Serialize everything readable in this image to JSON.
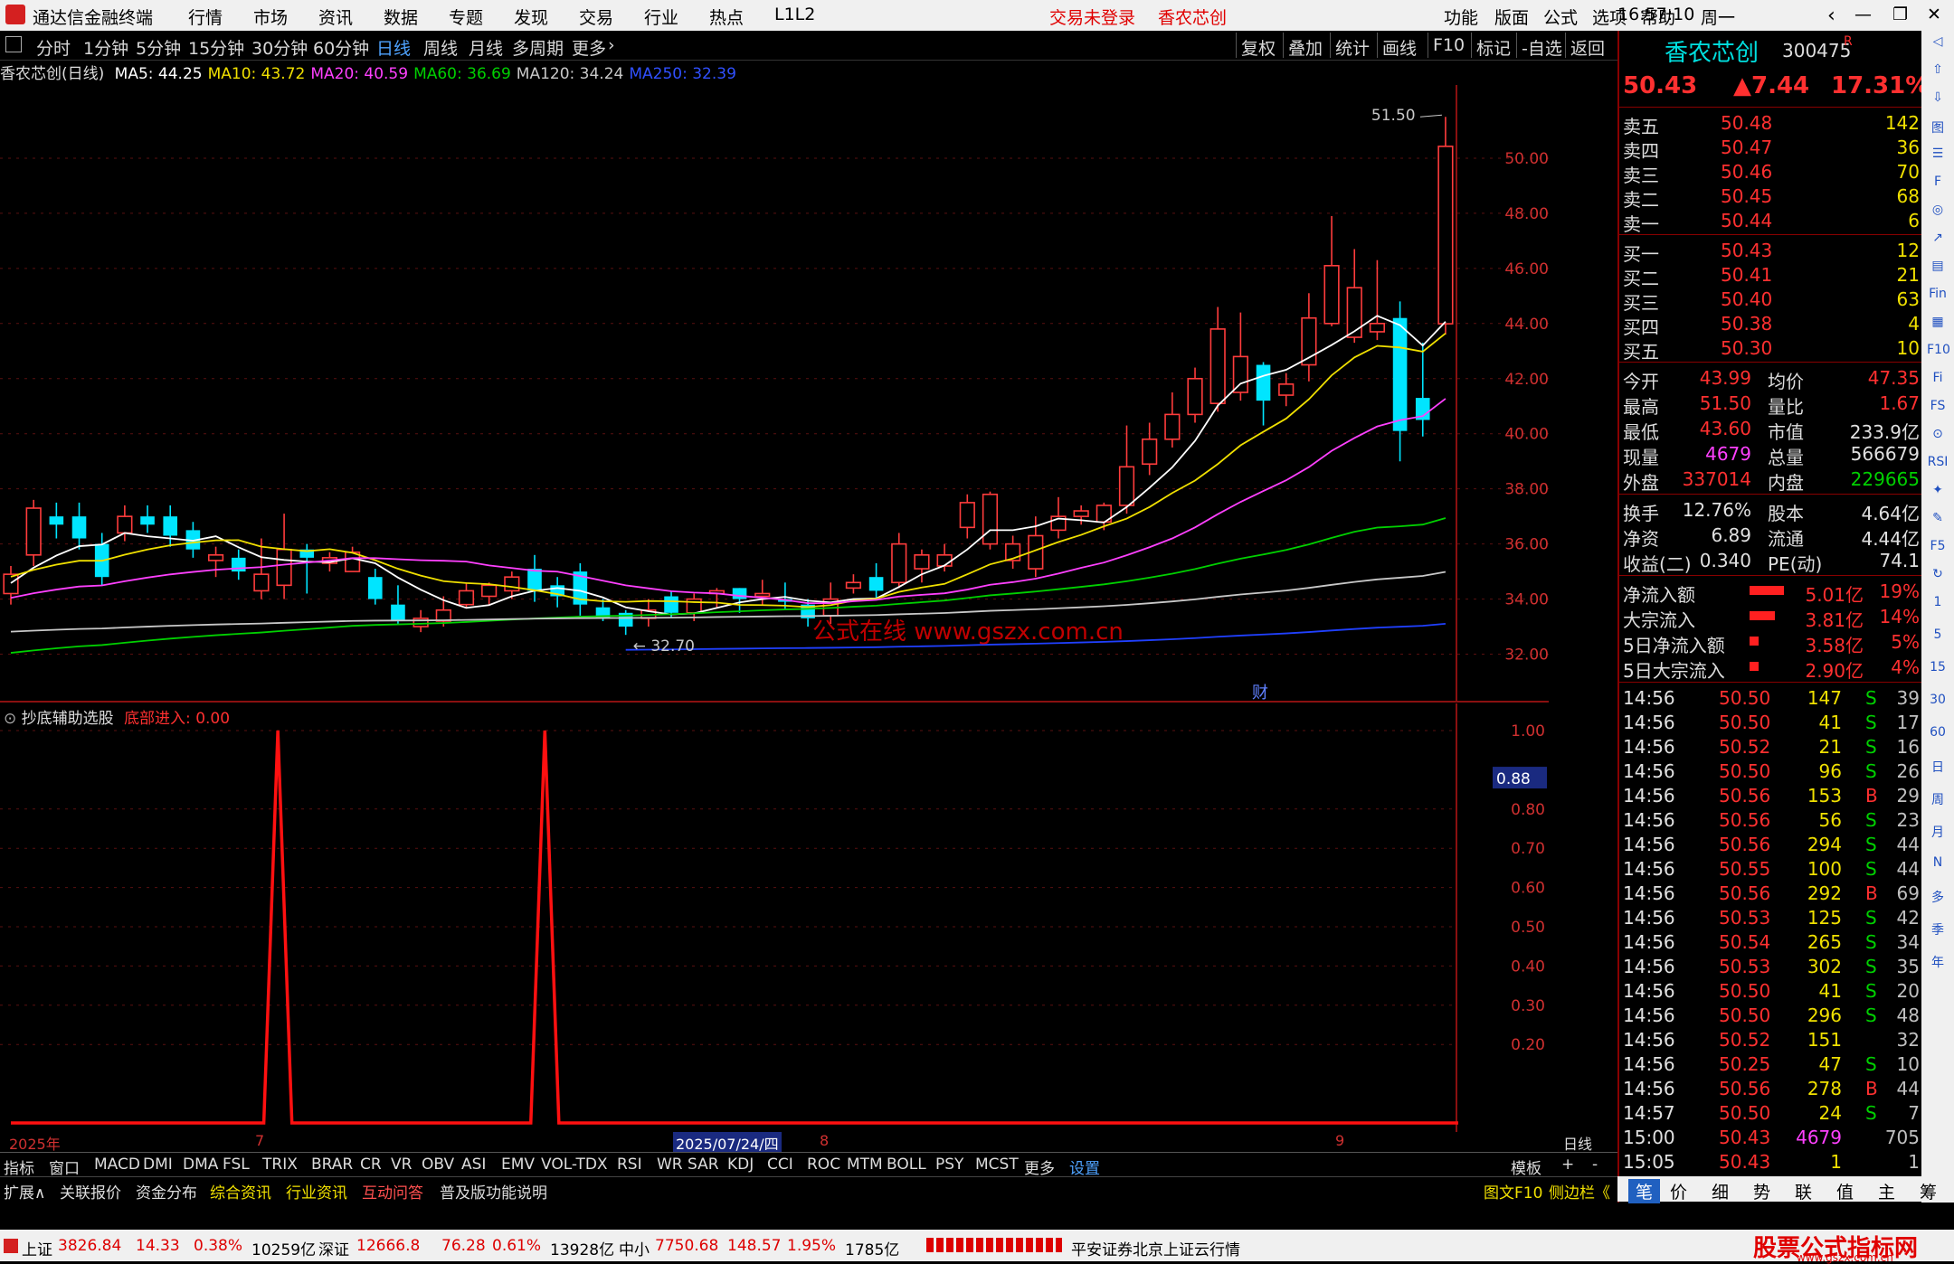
{
  "titlebar": {
    "app_name": "通达信金融终端",
    "menus": [
      "行情",
      "市场",
      "资讯",
      "数据",
      "专题",
      "发现",
      "交易",
      "行业",
      "热点",
      "L1L2"
    ],
    "trade_status": "交易未登录",
    "stock_name_title": "香农芯创",
    "right_menus": [
      "功能",
      "版面",
      "公式",
      "选项",
      "帮助"
    ],
    "clock": "16:57:10",
    "weekday": "周一"
  },
  "periodbar": {
    "periods": [
      "分时",
      "1分钟",
      "5分钟",
      "15分钟",
      "30分钟",
      "60分钟",
      "日线",
      "周线",
      "月线",
      "多周期",
      "更多"
    ],
    "active_period": "日线",
    "right_tools": [
      "复权",
      "叠加",
      "统计",
      "画线",
      "F10",
      "标记",
      "-自选",
      "返回"
    ]
  },
  "infoline": {
    "stock_label": "香农芯创(日线)",
    "ma": [
      {
        "label": "MA5: 44.25",
        "color": "#ffffff"
      },
      {
        "label": "MA10: 43.72",
        "color": "#f0e000"
      },
      {
        "label": "MA20: 40.59",
        "color": "#ff40ff"
      },
      {
        "label": "MA60: 36.69",
        "color": "#00d000"
      },
      {
        "label": "MA120: 34.24",
        "color": "#c8c8c8"
      },
      {
        "label": "MA250: 32.39",
        "color": "#3050ff"
      }
    ]
  },
  "mainchart": {
    "price_ticks": [
      "50.00",
      "48.00",
      "46.00",
      "44.00",
      "42.00",
      "40.00",
      "38.00",
      "36.00",
      "34.00",
      "32.00"
    ],
    "high_marker": "51.50",
    "low_marker": "32.70",
    "watermark": "公式在线 www.gszx.com.cn",
    "fin_label": "财"
  },
  "subchart": {
    "title": "抄底辅助选股",
    "indicator_label": "底部进入: 0.00",
    "ticks": [
      "1.00",
      "0.80",
      "0.70",
      "0.60",
      "0.50",
      "0.40",
      "0.30",
      "0.20"
    ],
    "cursor_value": "0.88",
    "signal_values": [
      0,
      0,
      0,
      0,
      0,
      0,
      0,
      0,
      0,
      0,
      0,
      0,
      0,
      0,
      0,
      0,
      0,
      0,
      0,
      1,
      0,
      0,
      0,
      0,
      0,
      0,
      0,
      0,
      0,
      0,
      0,
      0,
      0,
      0,
      0,
      0,
      0,
      0,
      1,
      0,
      0,
      0,
      0,
      0,
      0,
      0,
      0,
      0,
      0,
      0,
      0,
      0,
      0,
      0,
      0,
      0,
      0,
      0,
      0,
      0,
      0,
      0,
      0,
      0,
      0,
      0,
      0,
      0,
      0,
      0,
      0,
      0,
      0,
      0,
      0,
      0,
      0,
      0,
      0,
      0,
      0,
      0,
      0,
      0,
      0,
      0,
      0,
      0,
      0,
      0,
      0,
      0,
      0,
      0,
      0,
      0,
      0,
      0,
      0,
      0,
      0,
      0,
      0,
      0
    ]
  },
  "axisrow": {
    "labels": [
      "2025年",
      "7",
      "2025/07/24/四",
      "8",
      "9"
    ],
    "period_label": "日线"
  },
  "indbar": {
    "items": [
      "指标",
      "窗口",
      "MACD",
      "DMI",
      "DMA",
      "FSL",
      "TRIX",
      "BRAR",
      "CR",
      "VR",
      "OBV",
      "ASI",
      "EMV",
      "VOL-TDX",
      "RSI",
      "WR",
      "SAR",
      "KDJ",
      "CCI",
      "ROC",
      "MTM",
      "BOLL",
      "PSY",
      "MCST",
      "更多",
      "设置"
    ],
    "right": [
      "模板",
      "+",
      "-"
    ]
  },
  "extbar": {
    "items": [
      "扩展∧",
      "关联报价",
      "资金分布",
      "综合资讯",
      "行业资讯",
      "互动问答",
      "普及版功能说明"
    ],
    "right": [
      "图文F10",
      "侧边栏《"
    ]
  },
  "quote": {
    "name": "香农芯创",
    "code": "300475",
    "flag": "R",
    "price": "50.43",
    "change": "▲7.44",
    "pct": "17.31%",
    "asks": [
      {
        "label": "卖五",
        "price": "50.48",
        "vol": "142"
      },
      {
        "label": "卖四",
        "price": "50.47",
        "vol": "36"
      },
      {
        "label": "卖三",
        "price": "50.46",
        "vol": "70"
      },
      {
        "label": "卖二",
        "price": "50.45",
        "vol": "68"
      },
      {
        "label": "卖一",
        "price": "50.44",
        "vol": "6"
      }
    ],
    "bids": [
      {
        "label": "买一",
        "price": "50.43",
        "vol": "12"
      },
      {
        "label": "买二",
        "price": "50.41",
        "vol": "21"
      },
      {
        "label": "买三",
        "price": "50.40",
        "vol": "63"
      },
      {
        "label": "买四",
        "price": "50.38",
        "vol": "4"
      },
      {
        "label": "买五",
        "price": "50.30",
        "vol": "10"
      }
    ],
    "stats": [
      {
        "l1": "今开",
        "v1": "43.99",
        "l2": "均价",
        "v2": "47.35",
        "c1": "red",
        "c2": "red"
      },
      {
        "l1": "最高",
        "v1": "51.50",
        "l2": "量比",
        "v2": "1.67",
        "c1": "red",
        "c2": "red"
      },
      {
        "l1": "最低",
        "v1": "43.60",
        "l2": "市值",
        "v2": "233.9亿",
        "c1": "red",
        "c2": "white"
      },
      {
        "l1": "现量",
        "v1": "4679",
        "l2": "总量",
        "v2": "566679",
        "c1": "magenta",
        "c2": "white"
      },
      {
        "l1": "外盘",
        "v1": "337014",
        "l2": "内盘",
        "v2": "229665",
        "c1": "red",
        "c2": "green"
      }
    ],
    "stats2": [
      {
        "l1": "换手",
        "v1": "12.76%",
        "l2": "股本",
        "v2": "4.64亿"
      },
      {
        "l1": "净资",
        "v1": "6.89",
        "l2": "流通",
        "v2": "4.44亿"
      },
      {
        "l1": "收益(二)",
        "v1": "0.340",
        "l2": "PE(动)",
        "v2": "74.1"
      }
    ],
    "flows": [
      {
        "label": "净流入额",
        "value": "5.01亿",
        "pct": "19%",
        "bar": 0.19
      },
      {
        "label": "大宗流入",
        "value": "3.81亿",
        "pct": "14%",
        "bar": 0.14
      },
      {
        "label": "5日净流入额",
        "value": "3.58亿",
        "pct": "5%",
        "bar": 0.05
      },
      {
        "label": "5日大宗流入",
        "value": "2.90亿",
        "pct": "4%",
        "bar": 0.04
      }
    ],
    "ticks": [
      {
        "t": "14:56",
        "p": "50.50",
        "v": "147",
        "s": "S",
        "n": "39"
      },
      {
        "t": "14:56",
        "p": "50.50",
        "v": "41",
        "s": "S",
        "n": "17"
      },
      {
        "t": "14:56",
        "p": "50.52",
        "v": "21",
        "s": "S",
        "n": "16"
      },
      {
        "t": "14:56",
        "p": "50.50",
        "v": "96",
        "s": "S",
        "n": "26"
      },
      {
        "t": "14:56",
        "p": "50.56",
        "v": "153",
        "s": "B",
        "n": "29"
      },
      {
        "t": "14:56",
        "p": "50.56",
        "v": "56",
        "s": "S",
        "n": "23"
      },
      {
        "t": "14:56",
        "p": "50.56",
        "v": "294",
        "s": "S",
        "n": "44"
      },
      {
        "t": "14:56",
        "p": "50.55",
        "v": "100",
        "s": "S",
        "n": "44"
      },
      {
        "t": "14:56",
        "p": "50.56",
        "v": "292",
        "s": "B",
        "n": "69"
      },
      {
        "t": "14:56",
        "p": "50.53",
        "v": "125",
        "s": "S",
        "n": "42"
      },
      {
        "t": "14:56",
        "p": "50.54",
        "v": "265",
        "s": "S",
        "n": "34"
      },
      {
        "t": "14:56",
        "p": "50.53",
        "v": "302",
        "s": "S",
        "n": "35"
      },
      {
        "t": "14:56",
        "p": "50.50",
        "v": "41",
        "s": "S",
        "n": "20"
      },
      {
        "t": "14:56",
        "p": "50.50",
        "v": "296",
        "s": "S",
        "n": "48"
      },
      {
        "t": "14:56",
        "p": "50.52",
        "v": "151",
        "s": "",
        "n": "32"
      },
      {
        "t": "14:56",
        "p": "50.25",
        "v": "47",
        "s": "S",
        "n": "10"
      },
      {
        "t": "14:56",
        "p": "50.56",
        "v": "278",
        "s": "B",
        "n": "44"
      },
      {
        "t": "14:57",
        "p": "50.50",
        "v": "24",
        "s": "S",
        "n": "7"
      },
      {
        "t": "15:00",
        "p": "50.43",
        "v": "4679",
        "s": "",
        "n": "705"
      },
      {
        "t": "15:05",
        "p": "50.43",
        "v": "1",
        "s": "",
        "n": "1"
      }
    ]
  },
  "bottomtabs": [
    "笔",
    "价",
    "细",
    "势",
    "联",
    "值",
    "主",
    "筹"
  ],
  "sidetools": [
    "◁",
    "⇧",
    "⇩",
    "图",
    "☰",
    "F",
    "◎",
    "↗",
    "▤",
    "Fin",
    "▦",
    "F10",
    "Fi",
    "FS",
    "⊙",
    "RSI",
    "✦",
    "✎",
    "F5",
    "↻",
    "1",
    "5",
    "15",
    "30",
    "60",
    "日",
    "周",
    "月",
    "N",
    "多",
    "季",
    "年"
  ],
  "statusbar": {
    "sh_label": "上证",
    "sh_value": "3826.84",
    "sh_chg": "14.33",
    "sh_pct": "0.38%",
    "sh_amt": "10259亿",
    "sz_label": "深证",
    "sz_value": "12666.8",
    "sz_chg": "76.28",
    "sz_pct": "0.61%",
    "sz_amt": "13928亿",
    "zx_label": "中小",
    "zx_value": "7750.68",
    "zx_chg": "148.57",
    "zx_pct": "1.95%",
    "zx_amt": "1785亿",
    "broker": "平安证券北京上证云行情",
    "brand_title": "股票公式指标网",
    "brand_url": "www.gszx.com.cn"
  },
  "chart_data": {
    "type": "candlestick",
    "title": "香农芯创(日线)",
    "ylim": [
      31,
      52
    ],
    "candles": [
      [
        34.2,
        34.9,
        33.8,
        35.2
      ],
      [
        35.6,
        37.3,
        35.2,
        37.6
      ],
      [
        37.0,
        36.7,
        36.2,
        37.5
      ],
      [
        37.0,
        36.2,
        35.8,
        37.5
      ],
      [
        36.0,
        34.8,
        34.5,
        36.4
      ],
      [
        36.4,
        37.0,
        36.1,
        37.4
      ],
      [
        37.0,
        36.7,
        36.4,
        37.4
      ],
      [
        37.0,
        36.3,
        35.9,
        37.4
      ],
      [
        36.5,
        35.8,
        35.5,
        36.8
      ],
      [
        35.4,
        35.6,
        34.8,
        35.9
      ],
      [
        35.5,
        35.0,
        34.7,
        35.8
      ],
      [
        34.3,
        34.9,
        34.0,
        36.2
      ],
      [
        34.5,
        35.8,
        34.0,
        37.1
      ],
      [
        35.8,
        35.5,
        34.2,
        36.0
      ],
      [
        35.3,
        35.5,
        35.0,
        35.7
      ],
      [
        35.0,
        35.7,
        35.0,
        35.9
      ],
      [
        34.8,
        34.0,
        33.8,
        35.1
      ],
      [
        33.8,
        33.2,
        33.1,
        34.5
      ],
      [
        33.0,
        33.3,
        32.8,
        33.6
      ],
      [
        33.2,
        33.6,
        33.0,
        34.1
      ],
      [
        33.8,
        34.3,
        33.7,
        34.6
      ],
      [
        34.1,
        34.5,
        33.8,
        34.6
      ],
      [
        34.3,
        34.8,
        34.0,
        35.0
      ],
      [
        35.1,
        34.3,
        33.9,
        35.6
      ],
      [
        34.5,
        34.1,
        33.7,
        34.8
      ],
      [
        35.0,
        33.8,
        33.4,
        35.3
      ],
      [
        33.7,
        33.3,
        33.2,
        34.0
      ],
      [
        33.5,
        33.0,
        32.7,
        33.6
      ],
      [
        33.3,
        33.6,
        33.0,
        34.0
      ],
      [
        34.1,
        33.5,
        33.3,
        34.3
      ],
      [
        33.5,
        34.0,
        33.2,
        34.2
      ],
      [
        34.2,
        34.3,
        33.7,
        34.4
      ],
      [
        34.4,
        34.0,
        33.5,
        34.4
      ],
      [
        34.1,
        34.2,
        33.8,
        34.7
      ],
      [
        34.0,
        33.9,
        33.6,
        34.6
      ],
      [
        33.8,
        33.3,
        33.0,
        34.0
      ],
      [
        33.4,
        34.0,
        33.1,
        34.6
      ],
      [
        34.4,
        34.6,
        34.2,
        34.9
      ],
      [
        34.8,
        34.3,
        34.0,
        35.3
      ],
      [
        34.6,
        36.0,
        34.4,
        36.4
      ],
      [
        35.1,
        35.6,
        34.6,
        35.8
      ],
      [
        35.2,
        35.6,
        35.0,
        36.0
      ],
      [
        36.6,
        37.5,
        36.2,
        37.8
      ],
      [
        36.0,
        37.8,
        35.8,
        37.9
      ],
      [
        35.4,
        36.0,
        35.1,
        36.3
      ],
      [
        35.1,
        36.3,
        34.8,
        37.0
      ],
      [
        36.5,
        37.0,
        36.2,
        37.7
      ],
      [
        37.0,
        37.2,
        36.7,
        37.4
      ],
      [
        36.8,
        37.4,
        36.5,
        37.5
      ],
      [
        37.4,
        38.8,
        37.1,
        40.3
      ],
      [
        38.9,
        39.8,
        38.5,
        40.4
      ],
      [
        39.8,
        40.7,
        39.5,
        41.5
      ],
      [
        40.7,
        42.0,
        40.4,
        42.4
      ],
      [
        41.1,
        43.8,
        40.8,
        44.6
      ],
      [
        41.5,
        42.8,
        41.2,
        44.4
      ],
      [
        42.5,
        41.2,
        40.3,
        42.6
      ],
      [
        41.4,
        41.8,
        41.0,
        42.2
      ],
      [
        42.5,
        44.2,
        41.9,
        45.1
      ],
      [
        44.0,
        46.1,
        43.9,
        47.9
      ],
      [
        43.5,
        45.3,
        43.3,
        46.7
      ],
      [
        43.7,
        44.0,
        43.4,
        46.3
      ],
      [
        44.2,
        40.1,
        39.0,
        44.8
      ],
      [
        41.3,
        40.5,
        39.9,
        43.3
      ],
      [
        43.99,
        50.43,
        43.6,
        51.5
      ]
    ]
  }
}
